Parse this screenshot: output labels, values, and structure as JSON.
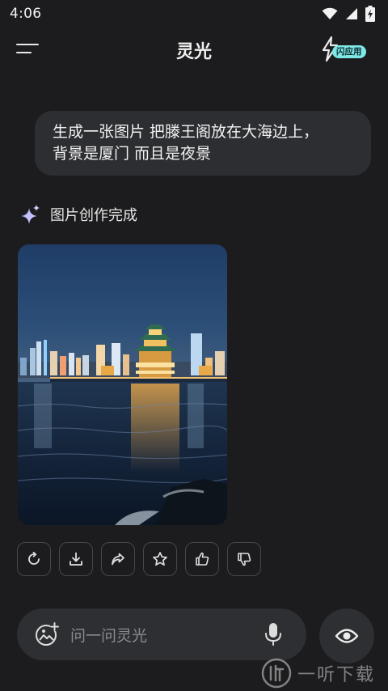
{
  "status_bar": {
    "time": "4:06"
  },
  "header": {
    "title": "灵光",
    "flash_tag": "闪应用"
  },
  "chat": {
    "user_message_line1": "生成一张图片 把滕王阁放在大海边上，",
    "user_message_line2": "背景是厦门 而且是夜景",
    "assistant_status": "图片创作完成"
  },
  "actions": [
    {
      "icon": "regenerate-icon"
    },
    {
      "icon": "download-icon"
    },
    {
      "icon": "share-icon"
    },
    {
      "icon": "star-icon"
    },
    {
      "icon": "thumbs-up-icon"
    },
    {
      "icon": "thumbs-down-icon"
    }
  ],
  "input": {
    "placeholder": "问一问灵光"
  },
  "watermark": {
    "text": "一听下载"
  },
  "colors": {
    "background": "#1c1c1e",
    "bubble": "#2d2e32",
    "accent": "#7de8e6"
  }
}
